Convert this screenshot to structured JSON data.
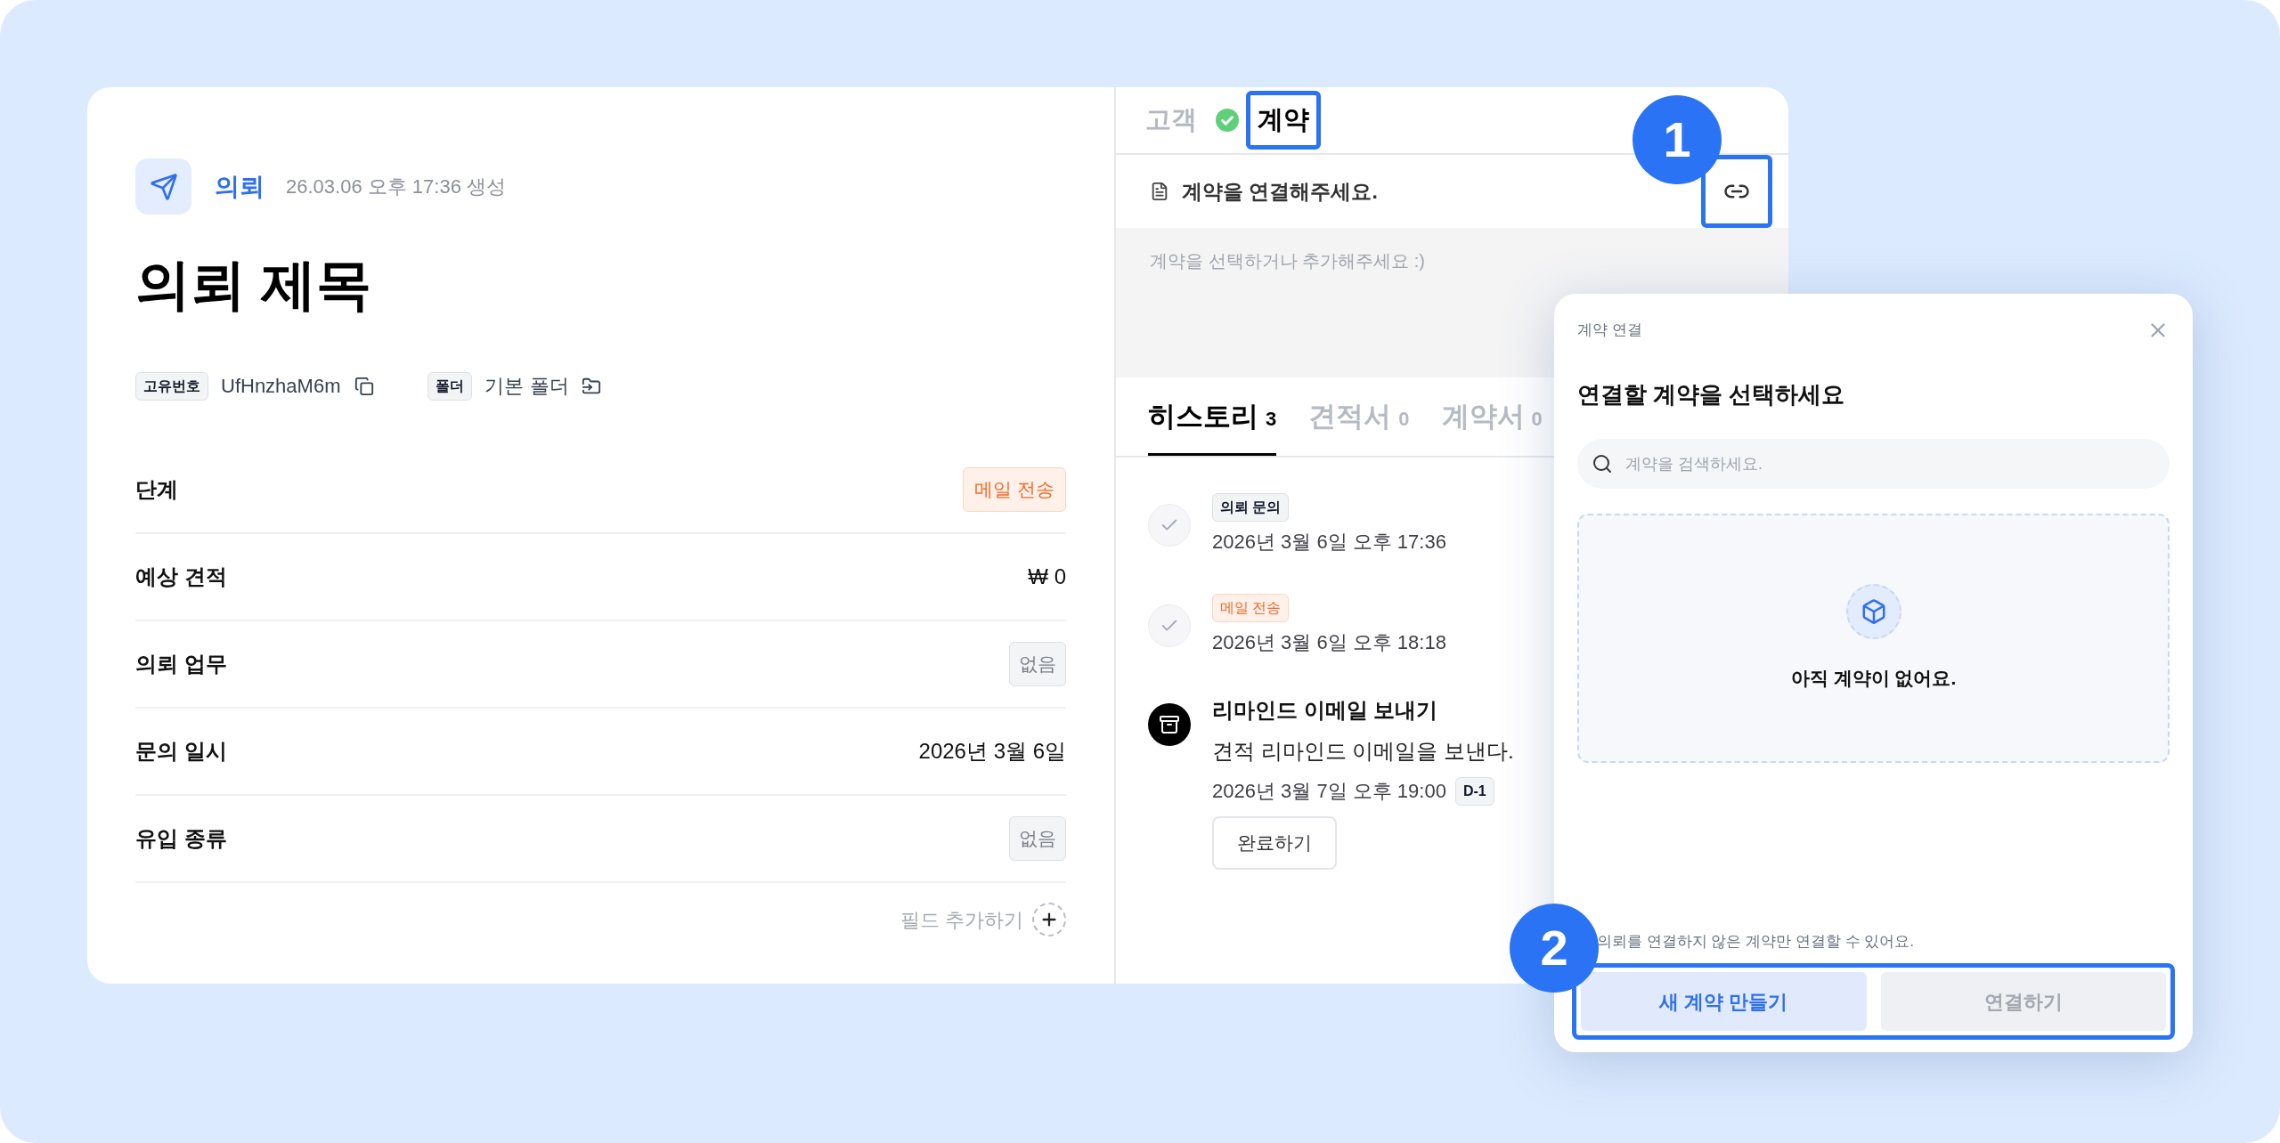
{
  "record": {
    "type_label": "의뢰",
    "created": "26.03.06 오후 17:36 생성",
    "title": "의뢰 제목",
    "meta": [
      {
        "label": "고유번호",
        "value": "UfHnzhaM6m",
        "kind": "copy"
      },
      {
        "label": "폴더",
        "value": "기본 폴더",
        "kind": "folder"
      }
    ]
  },
  "fields": [
    {
      "label": "단계",
      "value": "메일 전송",
      "kind": "status"
    },
    {
      "label": "예상 견적",
      "value": "₩ 0",
      "kind": "text"
    },
    {
      "label": "의뢰 업무",
      "value": "없음",
      "kind": "empty"
    },
    {
      "label": "문의 일시",
      "value": "2026년 3월 6일",
      "kind": "text"
    },
    {
      "label": "유입 종류",
      "value": "없음",
      "kind": "empty"
    }
  ],
  "add_field": "필드 추가하기",
  "relation_tabs": [
    {
      "label": "고객",
      "selected": false,
      "done": true,
      "highlighted": false
    },
    {
      "label": "계약",
      "selected": true,
      "done": false,
      "highlighted": true
    }
  ],
  "contract": {
    "prompt": "계약을 연결해주세요.",
    "hint": "계약을 선택하거나 추가해주세요 :)",
    "link_highlighted": true
  },
  "history_tabs": [
    {
      "label": "히스토리",
      "count": "3",
      "selected": true
    },
    {
      "label": "견적서",
      "count": "0",
      "selected": false
    },
    {
      "label": "계약서",
      "count": "0",
      "selected": false
    }
  ],
  "history": [
    {
      "kind": "event",
      "tag": {
        "text": "의뢰 문의",
        "kind": "plain"
      },
      "time": "2026년 3월 6일 오후 17:36"
    },
    {
      "kind": "event",
      "tag": {
        "text": "메일 전송",
        "kind": "status"
      },
      "time": "2026년 3월 6일 오후 18:18"
    },
    {
      "kind": "task",
      "title": "리마인드 이메일 보내기",
      "description": "견적 리마인드 이메일을 보낸다.",
      "time": "2026년 3월 7일 오후 19:00",
      "due": "D-1",
      "action": "완료하기"
    }
  ],
  "dialog": {
    "caption": "계약 연결",
    "heading": "연결할 계약을 선택하세요",
    "search": {
      "placeholder": "계약을 검색하세요."
    },
    "empty": "아직 계약이 없어요.",
    "note": "의뢰를 연결하지 않은 계약만 연결할 수 있어요.",
    "actions_highlighted": true,
    "buttons": [
      {
        "label": "새 계약 만들기",
        "disabled": false
      },
      {
        "label": "연결하기",
        "disabled": true
      }
    ]
  },
  "callouts": [
    {
      "number": "1"
    },
    {
      "number": "2"
    }
  ]
}
